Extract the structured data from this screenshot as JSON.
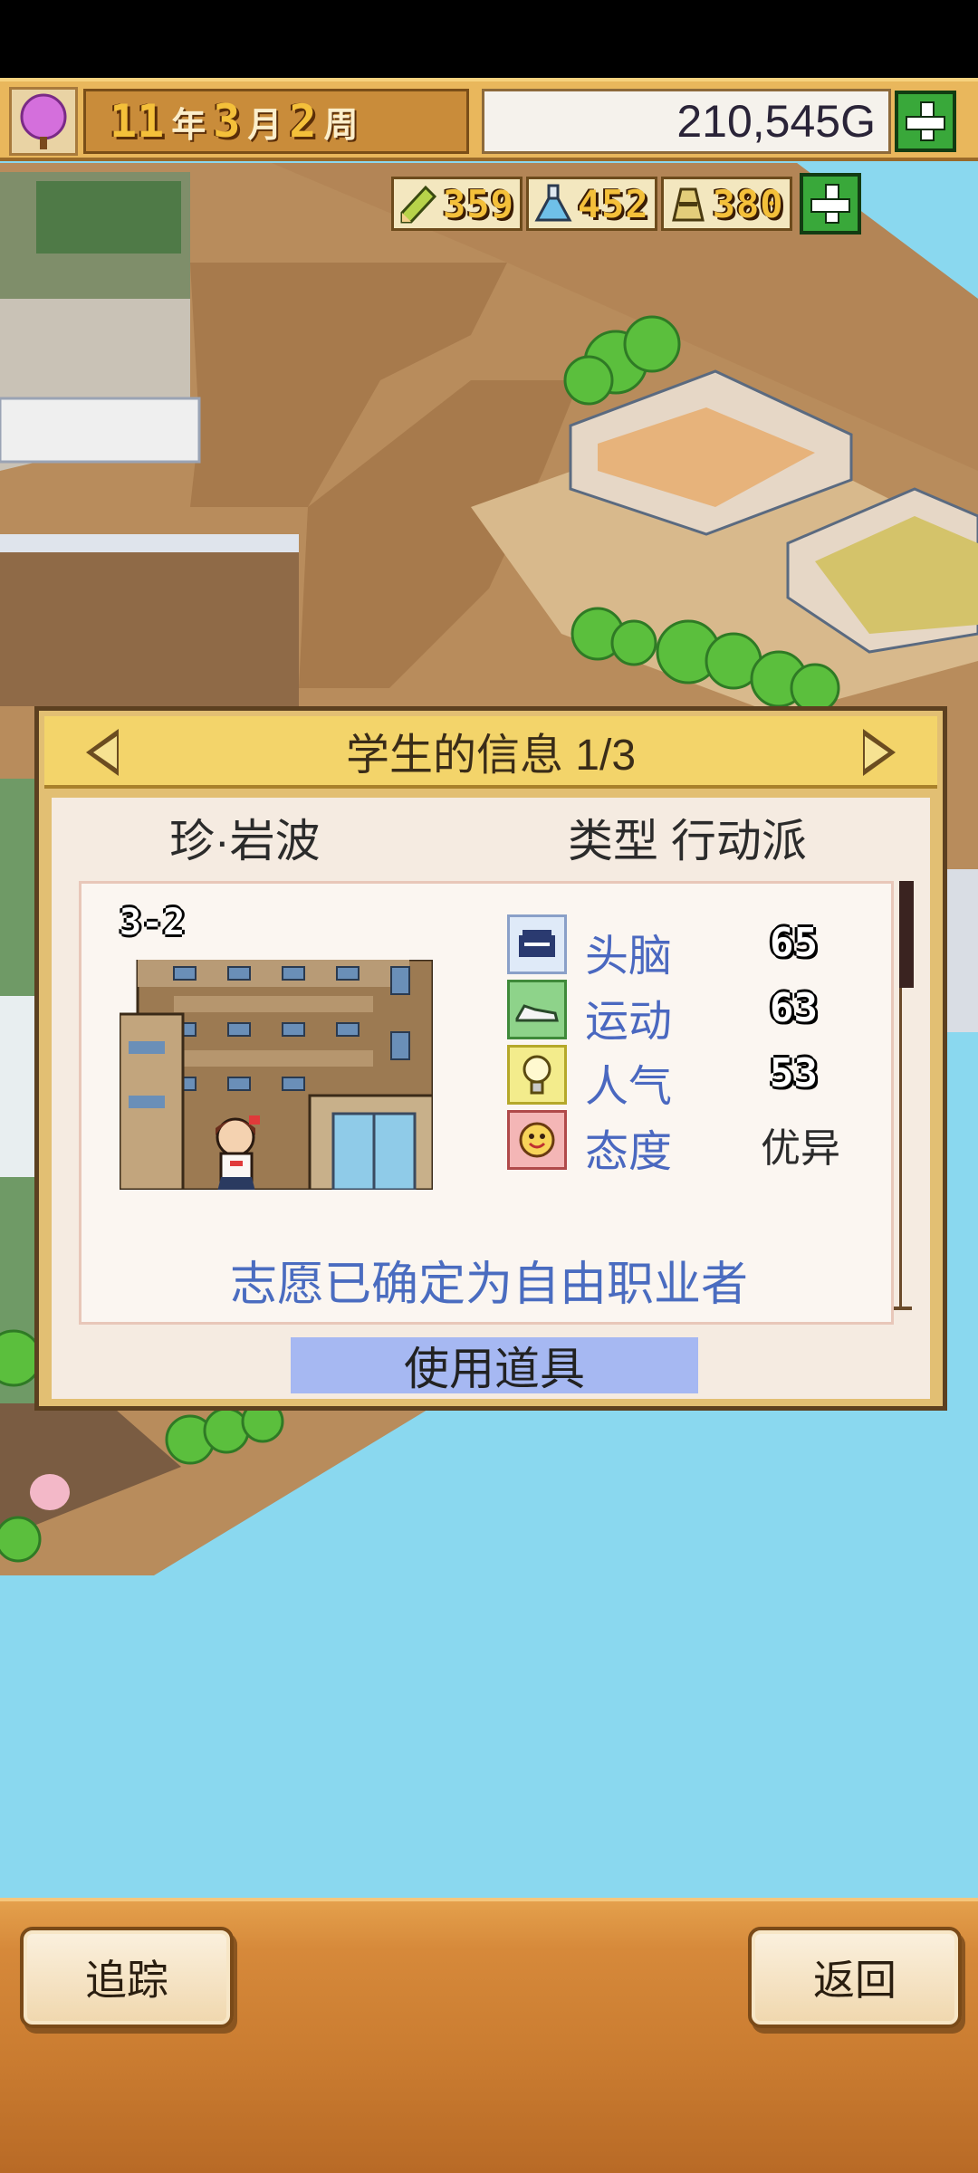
{
  "hud": {
    "year_num": "11",
    "year_unit": "年",
    "month_num": "3",
    "month_unit": "月",
    "week_num": "2",
    "week_unit": "周",
    "money": "210,545G",
    "resources": [
      {
        "icon": "pencil-icon",
        "value": "359"
      },
      {
        "icon": "flask-icon",
        "value": "452"
      },
      {
        "icon": "weight-icon",
        "value": "380"
      }
    ]
  },
  "dialog": {
    "title": "学生的信息 1/3",
    "student_name": "珍·岩波",
    "student_type": "类型 行动派",
    "class_label": "3-2",
    "stats": [
      {
        "label": "头脑",
        "value": "65",
        "icon": "brain-icon"
      },
      {
        "label": "运动",
        "value": "63",
        "icon": "sneaker-icon"
      },
      {
        "label": "人气",
        "value": "53",
        "icon": "lightbulb-icon"
      },
      {
        "label": "态度",
        "value": "优异",
        "icon": "smiley-icon"
      }
    ],
    "career": "志愿已确定为自由职业者",
    "use_item_label": "使用道具"
  },
  "bottom": {
    "track_label": "追踪",
    "back_label": "返回"
  },
  "colors": {
    "sea": "#8ad8ef",
    "dirt": "#b58a5a",
    "hud_gold": "#e9b75c",
    "dialog_header": "#f3d46a",
    "stat_label": "#4a68c0",
    "use_item_bg": "#a6b8f2"
  }
}
